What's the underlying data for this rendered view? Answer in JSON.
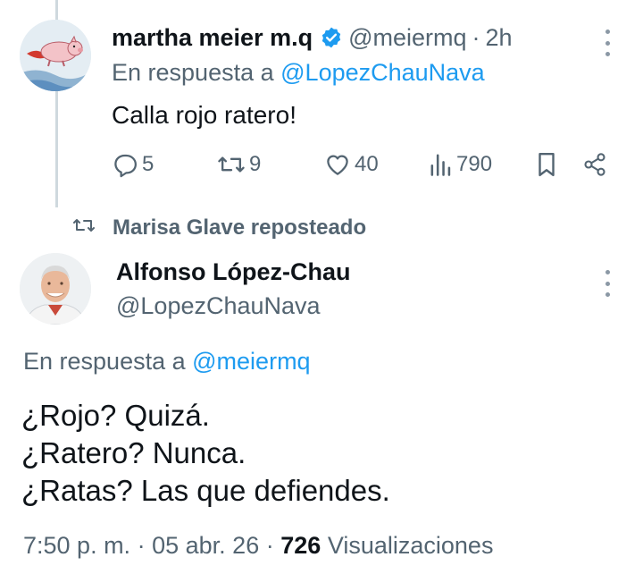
{
  "tweet1": {
    "name": "martha meier m.q",
    "handle": "@meiermq",
    "separator": "·",
    "time": "2h",
    "reply_prefix": "En respuesta a",
    "reply_mention": "@LopezChauNava",
    "text": "Calla rojo ratero!",
    "replies": "5",
    "reposts": "9",
    "likes": "40",
    "views": "790",
    "icons": [
      "verified-badge-icon",
      "more-icon",
      "reply-icon",
      "repost-icon",
      "like-icon",
      "views-icon",
      "bookmark-icon",
      "share-icon"
    ],
    "verified_color": "#1d9bf0"
  },
  "repost_banner": {
    "text": "Marisa Glave reposteado",
    "icon": "repost-icon"
  },
  "tweet2": {
    "name": "Alfonso López-Chau",
    "handle": "@LopezChauNava",
    "reply_prefix": "En respuesta a",
    "reply_mention": "@meiermq",
    "lines": [
      "¿Rojo? Quizá.",
      "¿Ratero? Nunca.",
      "¿Ratas? Las que defiendes."
    ],
    "time": "7:50 p. m.",
    "separator": "·",
    "date": "05 abr. 26",
    "views_count": "726",
    "views_label": "Visualizaciones"
  },
  "colors": {
    "accent": "#1d9bf0",
    "secondary_text": "#536471",
    "primary_text": "#0f1419",
    "thread_line": "#cfd9de"
  }
}
